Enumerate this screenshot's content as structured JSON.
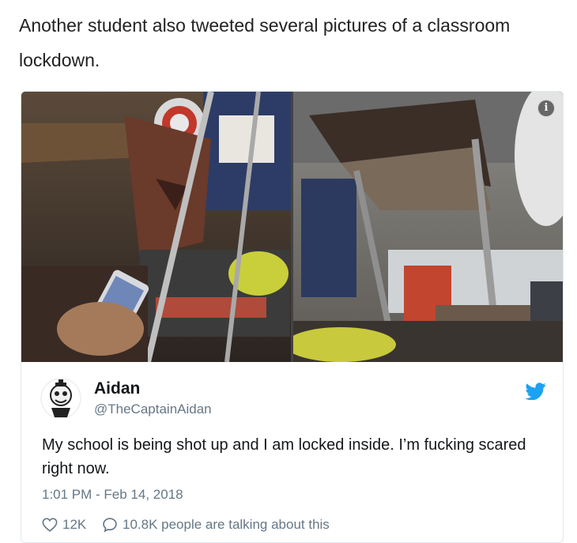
{
  "article": {
    "intro_text": "Another student also tweeted several pictures of a classroom lockdown."
  },
  "tweet": {
    "author_name": "Aidan",
    "author_handle": "@TheCaptainAidan",
    "text": "My school is being shot up and I am locked inside. I’m fucking scared right now.",
    "timestamp": "1:01 PM - Feb 14, 2018",
    "likes": "12K",
    "conversation": "10.8K people are talking about this",
    "info_glyph": "i",
    "colors": {
      "twitter_blue": "#1da1f2",
      "secondary_text": "#657786"
    },
    "icons": [
      "info-icon",
      "twitter-bird-icon",
      "heart-icon",
      "speech-bubble-icon"
    ]
  }
}
